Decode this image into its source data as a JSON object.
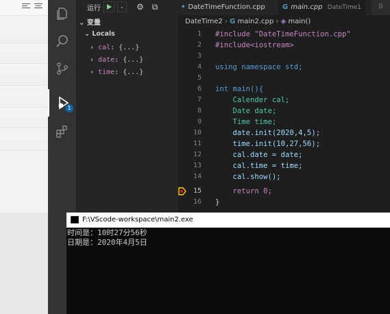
{
  "debug_toolbar": {
    "run_label": "运行"
  },
  "sidebar": {
    "section_title": "变量",
    "locals_label": "Locals",
    "variables": [
      {
        "name": "cal",
        "value": "{...}"
      },
      {
        "name": "date",
        "value": "{...}"
      },
      {
        "name": "time",
        "value": "{...}"
      }
    ]
  },
  "activity": {
    "debug_badge": "1"
  },
  "tabs": [
    {
      "label": "DateTimeFunction.cpp",
      "detail": ""
    },
    {
      "label": "main.cpp",
      "detail": "DateTime1"
    }
  ],
  "breadcrumb": {
    "folder": "DateTime2",
    "file": "main2.cpp",
    "symbol": "main()"
  },
  "code_lines": [
    {
      "n": "1",
      "text": "#include \"DateTimeFunction.cpp\""
    },
    {
      "n": "2",
      "text": "#include<iostream>"
    },
    {
      "n": "3",
      "text": ""
    },
    {
      "n": "4",
      "text": "using namespace std;"
    },
    {
      "n": "5",
      "text": ""
    },
    {
      "n": "6",
      "text": "int main(){"
    },
    {
      "n": "7",
      "text": "    Calender cal;"
    },
    {
      "n": "8",
      "text": "    Date date;"
    },
    {
      "n": "9",
      "text": "    Time time;"
    },
    {
      "n": "10",
      "text": "    date.init(2020,4,5);"
    },
    {
      "n": "11",
      "text": "    time.init(10,27,56);"
    },
    {
      "n": "12",
      "text": "    cal.date = date;"
    },
    {
      "n": "13",
      "text": "    cal.time = time;"
    },
    {
      "n": "14",
      "text": "    cal.show();"
    },
    {
      "n": "15",
      "text": "    return 0;"
    },
    {
      "n": "16",
      "text": "}"
    }
  ],
  "console": {
    "title": "F:\\VScode-workspace\\main2.exe",
    "lines": [
      "时间是：10时27分56秒",
      "日期是：2020年4月5日"
    ]
  }
}
